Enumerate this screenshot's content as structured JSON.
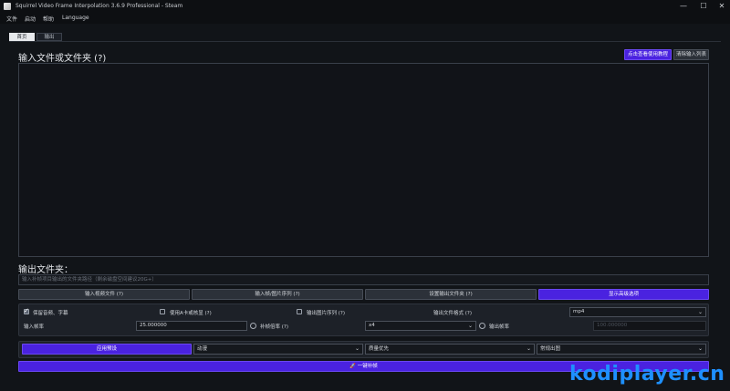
{
  "window": {
    "title": "Squirrel Video Frame Interpolation 3.6.9 Professional - Steam",
    "controls": {
      "minimize": "—",
      "maximize": "☐",
      "close": "✕"
    }
  },
  "menu": [
    "文件",
    "启动",
    "帮助",
    "Language"
  ],
  "tabs": [
    {
      "label": "首页",
      "active": true
    },
    {
      "label": "输出",
      "active": false
    }
  ],
  "input_section": {
    "title": "输入文件或文件夹 (?)",
    "tutorial_button": "点击查看使用教程",
    "clear_button": "清除输入列表"
  },
  "output_section": {
    "title": "输出文件夹：",
    "path_placeholder": "输入补帧项目输出的文件夹路径（剩余磁盘空间建议20G+）"
  },
  "action_buttons": [
    {
      "label": "输入视频文件 (?)",
      "style": "gray"
    },
    {
      "label": "输入帧/图片序列 (?)",
      "style": "gray"
    },
    {
      "label": "设置输出文件夹 (?)",
      "style": "gray"
    },
    {
      "label": "显示高级选项",
      "style": "purple"
    }
  ],
  "options": {
    "keep_audio": {
      "label": "保留音频、字幕",
      "checked": true
    },
    "use_a_card": {
      "label": "使用A卡或核显 (?)",
      "checked": false
    },
    "output_image_seq": {
      "label": "输出图片序列 (?)",
      "checked": false
    },
    "output_format_label": "输出文件格式 (?)",
    "output_format_value": "mp4",
    "input_fps_label": "输入帧率",
    "input_fps_value": "25.000000",
    "interp_ratio_label": "补帧倍率 (?)",
    "interp_ratio_value": "x4",
    "output_fps_label": "输出帧率",
    "output_fps_value": "100.000000"
  },
  "presets": {
    "apply_button": "应用预设",
    "preset_1": "动漫",
    "preset_2": "质量优先",
    "preset_3": "常规出图"
  },
  "start_button": "一键补帧",
  "start_icon": "rocket-icon",
  "watermark": "kodiplayer.cn",
  "colors": {
    "accent": "#4a22e0",
    "background": "#111418",
    "panel": "#1d2128",
    "watermark": "#1e90ff"
  }
}
